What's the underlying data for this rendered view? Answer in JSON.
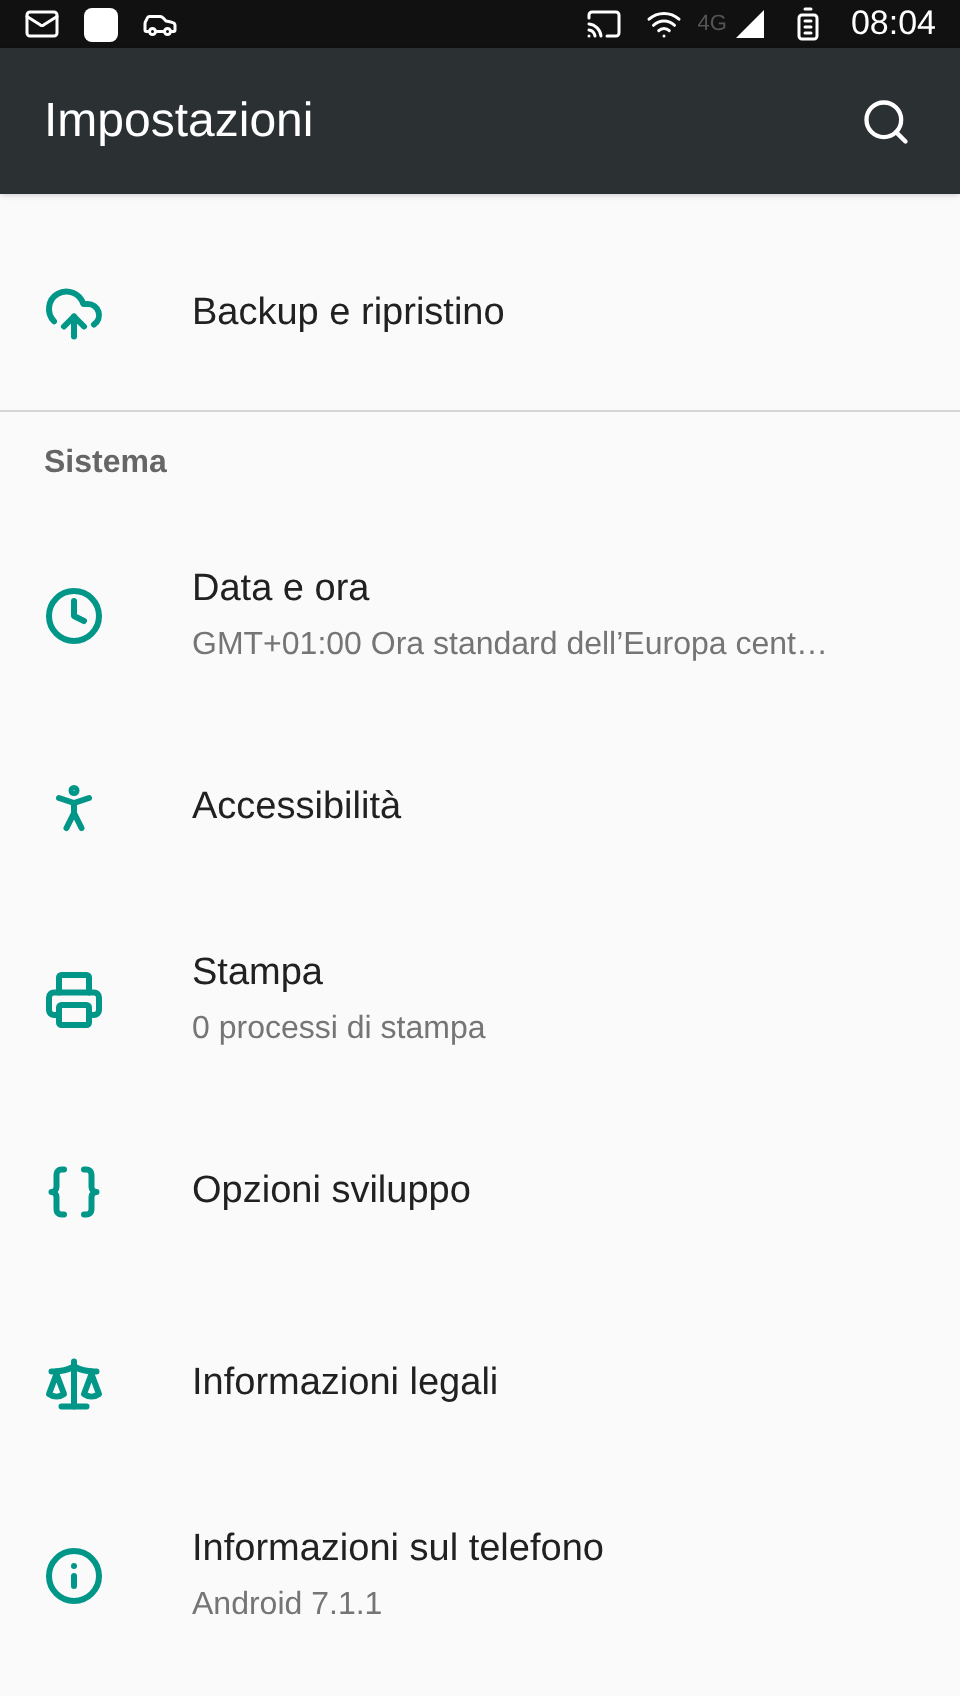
{
  "status_bar": {
    "network": "4G",
    "time": "08:04"
  },
  "toolbar": {
    "title": "Impostazioni"
  },
  "sections": [
    {
      "items": [
        {
          "title": "Backup e ripristino"
        }
      ]
    },
    {
      "header": "Sistema",
      "items": [
        {
          "title": "Data e ora",
          "subtitle": "GMT+01:00 Ora standard dell’Europa cent…"
        },
        {
          "title": "Accessibilità"
        },
        {
          "title": "Stampa",
          "subtitle": "0 processi di stampa"
        },
        {
          "title": "Opzioni sviluppo"
        },
        {
          "title": "Informazioni legali"
        },
        {
          "title": "Informazioni sul telefono",
          "subtitle": "Android 7.1.1"
        }
      ]
    }
  ]
}
